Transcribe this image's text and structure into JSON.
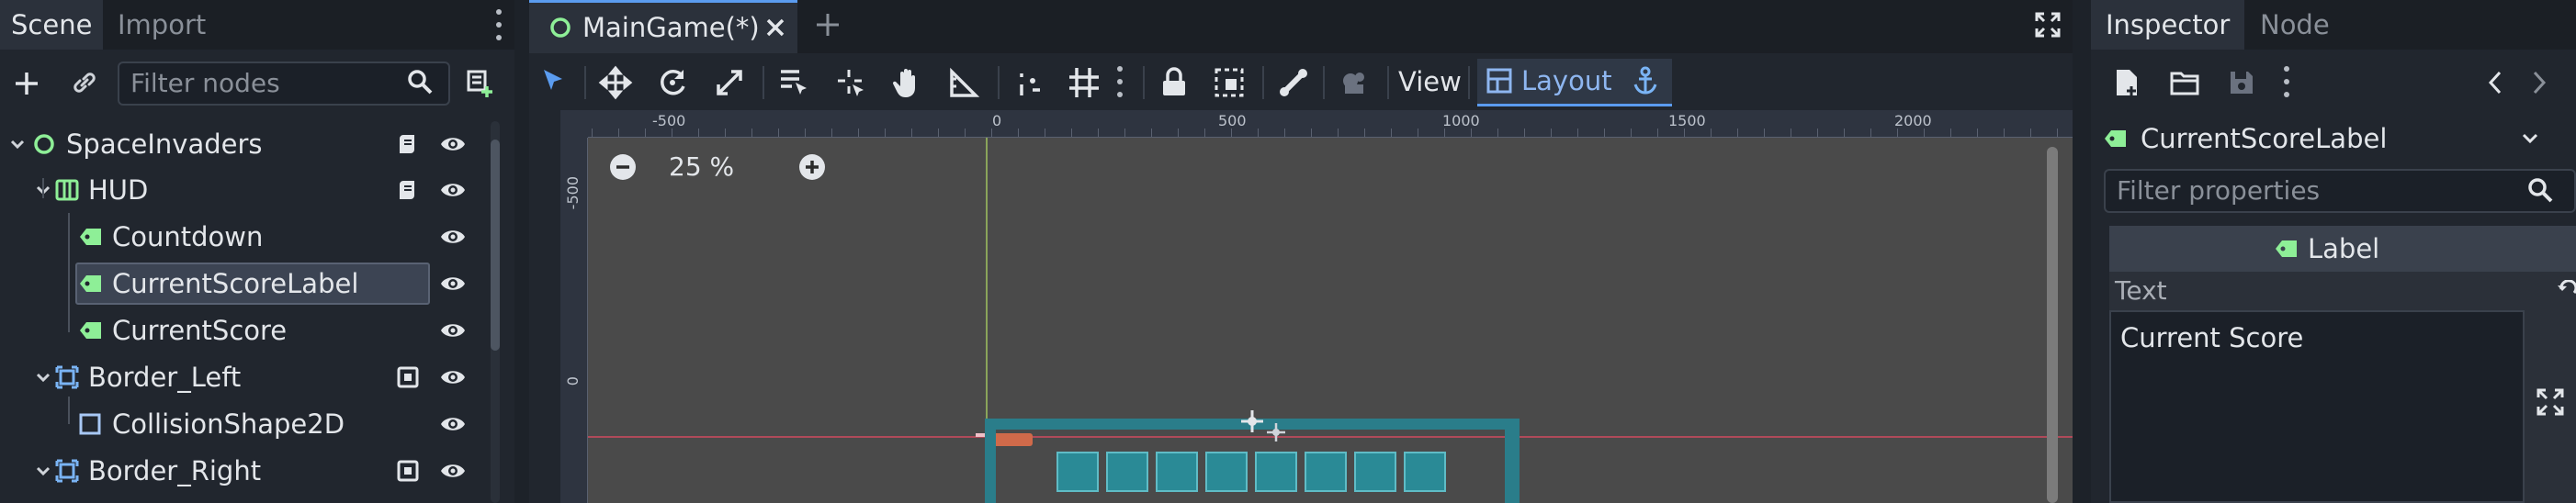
{
  "scene_dock": {
    "tabs": [
      "Scene",
      "Import"
    ],
    "filter_placeholder": "Filter nodes",
    "tree": [
      {
        "label": "SpaceInvaders",
        "icon": "node2d-circle-icon",
        "depth": 0,
        "expanded": true,
        "script": true,
        "visible": true
      },
      {
        "label": "HUD",
        "icon": "hud-container-icon",
        "depth": 1,
        "expanded": true,
        "script": true,
        "visible": true
      },
      {
        "label": "Countdown",
        "icon": "label-icon",
        "depth": 2,
        "visible": true
      },
      {
        "label": "CurrentScoreLabel",
        "icon": "label-icon",
        "depth": 2,
        "selected": true,
        "visible": true
      },
      {
        "label": "CurrentScore",
        "icon": "label-icon",
        "depth": 2,
        "visible": true
      },
      {
        "label": "Border_Left",
        "icon": "static-body-icon",
        "depth": 1,
        "expanded": true,
        "signal": true,
        "visible": true
      },
      {
        "label": "CollisionShape2D",
        "icon": "collision-shape-icon",
        "depth": 2,
        "visible": true
      },
      {
        "label": "Border_Right",
        "icon": "static-body-icon",
        "depth": 1,
        "expanded": true,
        "signal": true,
        "visible": true
      }
    ]
  },
  "editor": {
    "document_tab": "MainGame(*)",
    "toolbar": {
      "view_label": "View",
      "layout_label": "Layout"
    },
    "zoom": "25 %",
    "ruler_h": [
      "-500",
      "0",
      "500",
      "1000",
      "1500",
      "2000"
    ],
    "ruler_v": [
      "-500",
      "0"
    ]
  },
  "inspector": {
    "tabs": [
      "Inspector",
      "Node"
    ],
    "node_name": "CurrentScoreLabel",
    "filter_placeholder": "Filter properties",
    "section": "Label",
    "property": "Text",
    "text_value": "Current Score"
  },
  "colors": {
    "accent": "#5b9cf0",
    "label_icon": "#8eef97",
    "selection": "#3c4453",
    "viewport_bg": "#4a4a4a",
    "teal": "#2a7d8a"
  }
}
